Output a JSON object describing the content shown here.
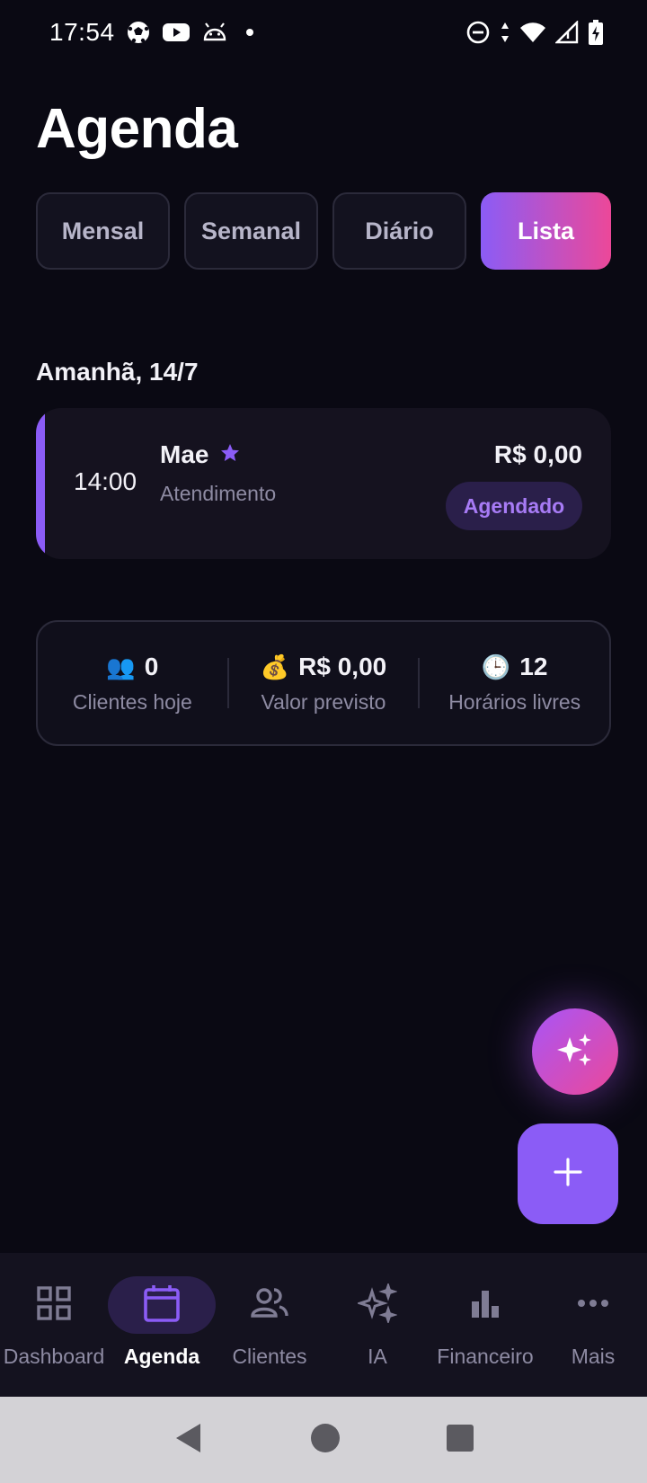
{
  "status_bar": {
    "time": "17:54"
  },
  "page": {
    "title": "Agenda"
  },
  "view_tabs": [
    {
      "label": "Mensal",
      "active": false
    },
    {
      "label": "Semanal",
      "active": false
    },
    {
      "label": "Diário",
      "active": false
    },
    {
      "label": "Lista",
      "active": true
    }
  ],
  "section": {
    "date_heading": "Amanhã, 14/7"
  },
  "appointment": {
    "time": "14:00",
    "client_name": "Mae",
    "service": "Atendimento",
    "price": "R$ 0,00",
    "status": "Agendado",
    "favorite_icon": "star-icon",
    "accent_color": "#8b5cf6"
  },
  "stats": [
    {
      "emoji": "👥",
      "value": "0",
      "label": "Clientes hoje"
    },
    {
      "emoji": "💰",
      "value": "R$ 0,00",
      "label": "Valor previsto"
    },
    {
      "emoji": "🕒",
      "value": "12",
      "label": "Horários livres"
    }
  ],
  "fabs": {
    "ai_icon": "sparkles-icon",
    "add_icon": "plus-icon"
  },
  "bottom_nav": [
    {
      "label": "Dashboard",
      "icon": "grid-icon",
      "active": false
    },
    {
      "label": "Agenda",
      "icon": "calendar-icon",
      "active": true
    },
    {
      "label": "Clientes",
      "icon": "people-icon",
      "active": false
    },
    {
      "label": "IA",
      "icon": "sparkles-icon",
      "active": false
    },
    {
      "label": "Financeiro",
      "icon": "bar-chart-icon",
      "active": false
    },
    {
      "label": "Mais",
      "icon": "more-icon",
      "active": false
    }
  ],
  "colors": {
    "background": "#0a0913",
    "accent": "#8b5cf6",
    "accent_pink": "#ec4899",
    "muted_text": "#8e8ba3"
  }
}
